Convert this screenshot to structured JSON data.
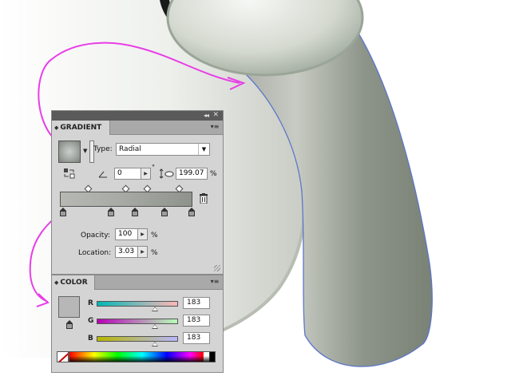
{
  "gradient_panel": {
    "tab_label": "GRADIENT",
    "collapse_arrows": "◂◂",
    "close_glyph": "✕",
    "menu_glyph": "▾≡",
    "type_label": "Type:",
    "type_value": "Radial",
    "angle_value": "0",
    "degree_symbol": "°",
    "aspect_value": "199.07",
    "aspect_unit": "%",
    "opacity_label": "Opacity:",
    "opacity_value": "100",
    "opacity_unit": "%",
    "location_label": "Location:",
    "location_value": "3.03",
    "location_unit": "%",
    "stop_colors": [
      "#9d9d9d",
      "#a4a4a4",
      "#a4a4a4",
      "#9a9a9a",
      "#909090"
    ]
  },
  "color_panel": {
    "tab_label": "COLOR",
    "menu_glyph": "▾≡",
    "swatch_color": "#b7b7b7",
    "channels": [
      {
        "label": "R",
        "value": "183",
        "fraction": 0.72,
        "gradient": "linear-gradient(to right,#00b7b7,#ffb7b7)"
      },
      {
        "label": "G",
        "value": "183",
        "fraction": 0.72,
        "gradient": "linear-gradient(to right,#b700b7,#b7ffb7)"
      },
      {
        "label": "B",
        "value": "183",
        "fraction": 0.72,
        "gradient": "linear-gradient(to right,#b7b700,#b7b7ff)"
      }
    ]
  },
  "icons": {
    "swap_stops": "swap-icon",
    "angle": "angle-icon",
    "aspect_ratio": "aspect-ratio-icon",
    "delete_stop": "trash-icon",
    "none_color": "none-color-icon"
  },
  "colors": {
    "annotation_magenta": "#e83ee8",
    "path_outline_blue": "#5d76c9",
    "panel_bg": "#d4d4d4"
  }
}
